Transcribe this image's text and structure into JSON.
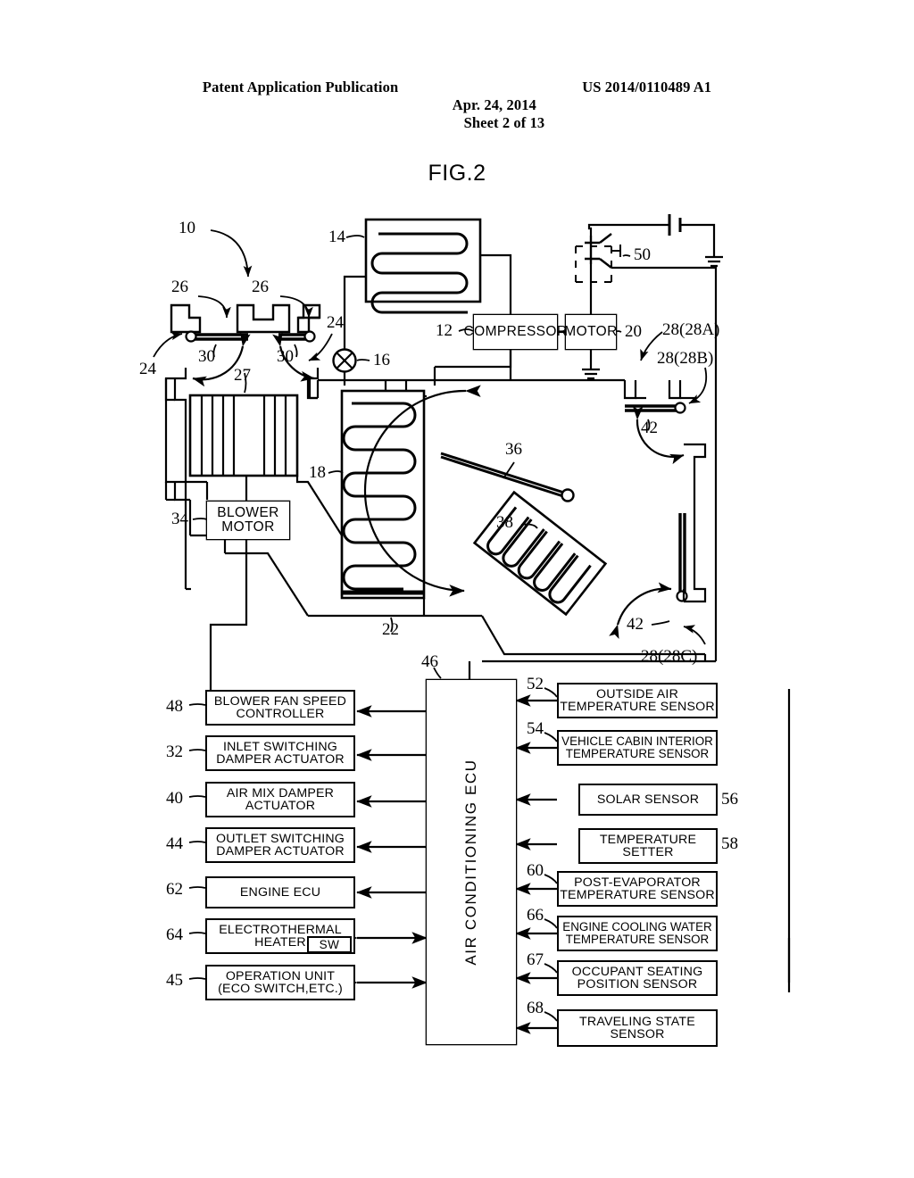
{
  "header": {
    "publication": "Patent Application Publication",
    "date": "Apr. 24, 2014",
    "sheet": "Sheet 2 of 13",
    "docnum": "US 2014/0110489 A1"
  },
  "figure": {
    "caption": "FIG.2"
  },
  "components": {
    "compressor": "COMPRESSOR",
    "motor": "MOTOR",
    "blower_motor": "BLOWER\nMOTOR",
    "blower_motor_line1": "BLOWER",
    "blower_motor_line2": "MOTOR",
    "ecu": "AIR CONDITIONING ECU"
  },
  "left_blocks": [
    {
      "ref": "48",
      "line1": "BLOWER FAN SPEED",
      "line2": "CONTROLLER"
    },
    {
      "ref": "32",
      "line1": "INLET SWITCHING",
      "line2": "DAMPER ACTUATOR"
    },
    {
      "ref": "40",
      "line1": "AIR MIX DAMPER",
      "line2": "ACTUATOR"
    },
    {
      "ref": "44",
      "line1": "OUTLET SWITCHING",
      "line2": "DAMPER ACTUATOR"
    },
    {
      "ref": "62",
      "line1": "ENGINE ECU",
      "line2": ""
    },
    {
      "ref": "64",
      "line1": "ELECTROTHERMAL",
      "line2": "HEATER",
      "sub": "SW"
    },
    {
      "ref": "45",
      "line1": "OPERATION UNIT",
      "line2": "(ECO SWITCH,ETC.)"
    }
  ],
  "right_blocks": [
    {
      "ref": "52",
      "line1": "OUTSIDE AIR",
      "line2": "TEMPERATURE SENSOR",
      "ref_side": "left"
    },
    {
      "ref": "54",
      "line1": "VEHICLE CABIN INTERIOR",
      "line2": "TEMPERATURE SENSOR",
      "ref_side": "left"
    },
    {
      "ref": "56",
      "line1": "SOLAR SENSOR",
      "line2": "",
      "ref_side": "right"
    },
    {
      "ref": "58",
      "line1": "TEMPERATURE",
      "line2": "SETTER",
      "ref_side": "right"
    },
    {
      "ref": "60",
      "line1": "POST-EVAPORATOR",
      "line2": "TEMPERATURE SENSOR",
      "ref_side": "left"
    },
    {
      "ref": "66",
      "line1": "ENGINE COOLING WATER",
      "line2": "TEMPERATURE SENSOR",
      "ref_side": "left"
    },
    {
      "ref": "67",
      "line1": "OCCUPANT SEATING",
      "line2": "POSITION SENSOR",
      "ref_side": "left"
    },
    {
      "ref": "68",
      "line1": "TRAVELING STATE",
      "line2": "SENSOR",
      "ref_side": "left"
    }
  ],
  "refs": [
    {
      "id": "r10",
      "text": "10"
    },
    {
      "id": "r14",
      "text": "14"
    },
    {
      "id": "r12",
      "text": "12"
    },
    {
      "id": "r16",
      "text": "16"
    },
    {
      "id": "r18",
      "text": "18"
    },
    {
      "id": "r20",
      "text": "20"
    },
    {
      "id": "r22",
      "text": "22"
    },
    {
      "id": "r24a",
      "text": "24"
    },
    {
      "id": "r24b",
      "text": "24"
    },
    {
      "id": "r26a",
      "text": "26"
    },
    {
      "id": "r26b",
      "text": "26"
    },
    {
      "id": "r27",
      "text": "27"
    },
    {
      "id": "r30a",
      "text": "30"
    },
    {
      "id": "r30b",
      "text": "30"
    },
    {
      "id": "r34",
      "text": "34"
    },
    {
      "id": "r36",
      "text": "36"
    },
    {
      "id": "r38",
      "text": "38"
    },
    {
      "id": "r42a",
      "text": "42"
    },
    {
      "id": "r42b",
      "text": "42"
    },
    {
      "id": "r46",
      "text": "46"
    },
    {
      "id": "r50",
      "text": "50"
    },
    {
      "id": "r28a",
      "text": "28(28A)"
    },
    {
      "id": "r28b",
      "text": "28(28B)"
    },
    {
      "id": "r28c",
      "text": "28(28C)"
    }
  ],
  "colors": {
    "ink": "#000000",
    "paper": "#ffffff"
  }
}
